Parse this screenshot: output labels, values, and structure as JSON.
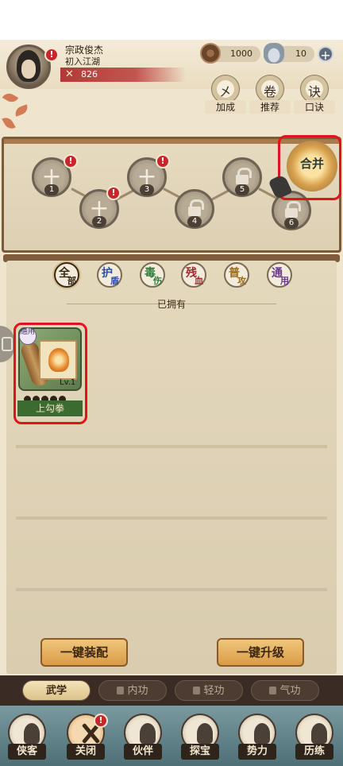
{
  "player": {
    "name": "宗政俊杰",
    "rank": "初入江湖",
    "power": "826",
    "alert": "!"
  },
  "resources": {
    "coins": "1000",
    "ingots": "10",
    "add": "+"
  },
  "top_actions": [
    {
      "glyph": "㐅",
      "label": "加成"
    },
    {
      "glyph": "卷",
      "label": "推荐"
    },
    {
      "glyph": "诀",
      "label": "口诀"
    }
  ],
  "slots": [
    {
      "num": "1",
      "state": "empty",
      "alert": "!"
    },
    {
      "num": "2",
      "state": "empty",
      "alert": "!"
    },
    {
      "num": "3",
      "state": "empty",
      "alert": "!"
    },
    {
      "num": "4",
      "state": "locked",
      "alert": ""
    },
    {
      "num": "5",
      "state": "locked",
      "alert": ""
    },
    {
      "num": "6",
      "state": "locked",
      "alert": ""
    }
  ],
  "combine_label": "合并",
  "filters": [
    {
      "c1": "全",
      "c2": "部",
      "color": "#3b2a1a",
      "active": true
    },
    {
      "c1": "护",
      "c2": "盾",
      "color": "#2c4fa0",
      "active": false
    },
    {
      "c1": "毒",
      "c2": "伤",
      "color": "#2f7a3c",
      "active": false
    },
    {
      "c1": "残",
      "c2": "血",
      "color": "#a0262f",
      "active": false
    },
    {
      "c1": "普",
      "c2": "攻",
      "color": "#9a6a12",
      "active": false
    },
    {
      "c1": "通",
      "c2": "用",
      "color": "#6a3b8c",
      "active": false
    }
  ],
  "owned_title": "已拥有",
  "items": [
    {
      "name": "上勾拳",
      "level": "Lv.1",
      "tag": "通用",
      "stars": 5
    }
  ],
  "buttons": {
    "equip_all": "一键装配",
    "upgrade_all": "一键升级"
  },
  "sub_tabs": [
    {
      "label": "武学",
      "active": true,
      "locked": false
    },
    {
      "label": "内功",
      "active": false,
      "locked": true
    },
    {
      "label": "轻功",
      "active": false,
      "locked": true
    },
    {
      "label": "气功",
      "active": false,
      "locked": true
    }
  ],
  "nav": [
    {
      "label": "侠客",
      "alert": ""
    },
    {
      "label": "关闭",
      "alert": "!"
    },
    {
      "label": "伙伴",
      "alert": ""
    },
    {
      "label": "探宝",
      "alert": ""
    },
    {
      "label": "势力",
      "alert": ""
    },
    {
      "label": "历练",
      "alert": ""
    }
  ]
}
